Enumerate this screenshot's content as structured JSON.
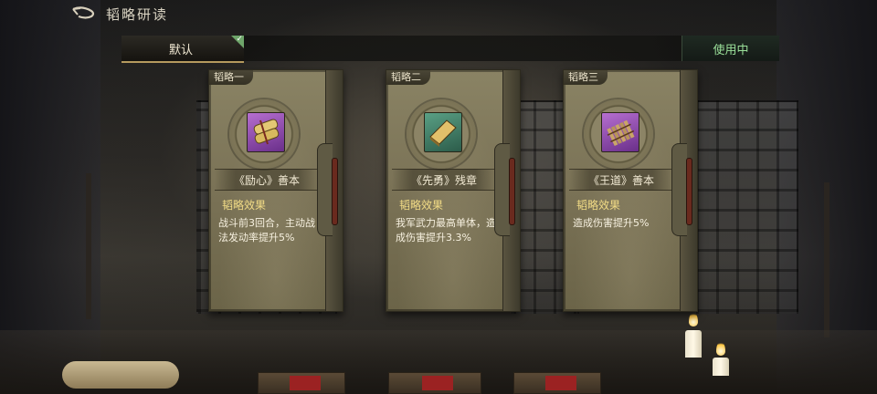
{
  "header": {
    "title": "韬略研读",
    "back_icon": "back-arrow-icon"
  },
  "tabs": {
    "default_label": "默认",
    "in_use_label": "使用中",
    "check_icon": "check-icon"
  },
  "cards": [
    {
      "tab": "韬略一",
      "name": "《励心》善本",
      "effect_label": "韬略效果",
      "effect_text": "战斗前3回合，主动战法发动率提升5%",
      "icon": "bound-scrolls-icon",
      "icon_color": "#9b58b8"
    },
    {
      "tab": "韬略二",
      "name": "《先勇》残章",
      "effect_label": "韬略效果",
      "effect_text": "我军武力最高单体，造成伤害提升3.3%",
      "icon": "closed-book-icon",
      "icon_color": "#3f7d66"
    },
    {
      "tab": "韬略三",
      "name": "《王道》善本",
      "effect_label": "韬略效果",
      "effect_text": "造成伤害提升5%",
      "icon": "bamboo-slips-icon",
      "icon_color": "#9b58b8"
    }
  ]
}
